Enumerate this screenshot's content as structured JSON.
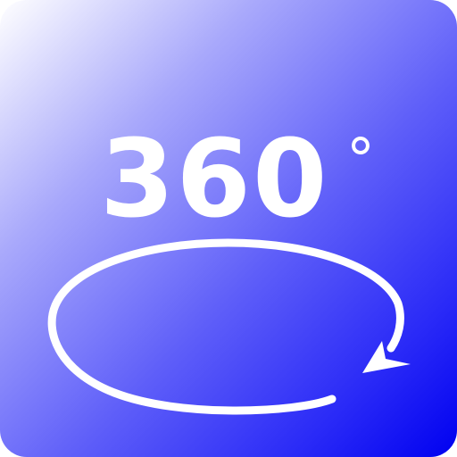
{
  "icon": {
    "name": "360-rotation-icon",
    "label": "360",
    "degree": "°",
    "colors": {
      "gradient_start": "#ffffff",
      "gradient_end": "#0000f0",
      "foreground": "#ffffff"
    }
  }
}
